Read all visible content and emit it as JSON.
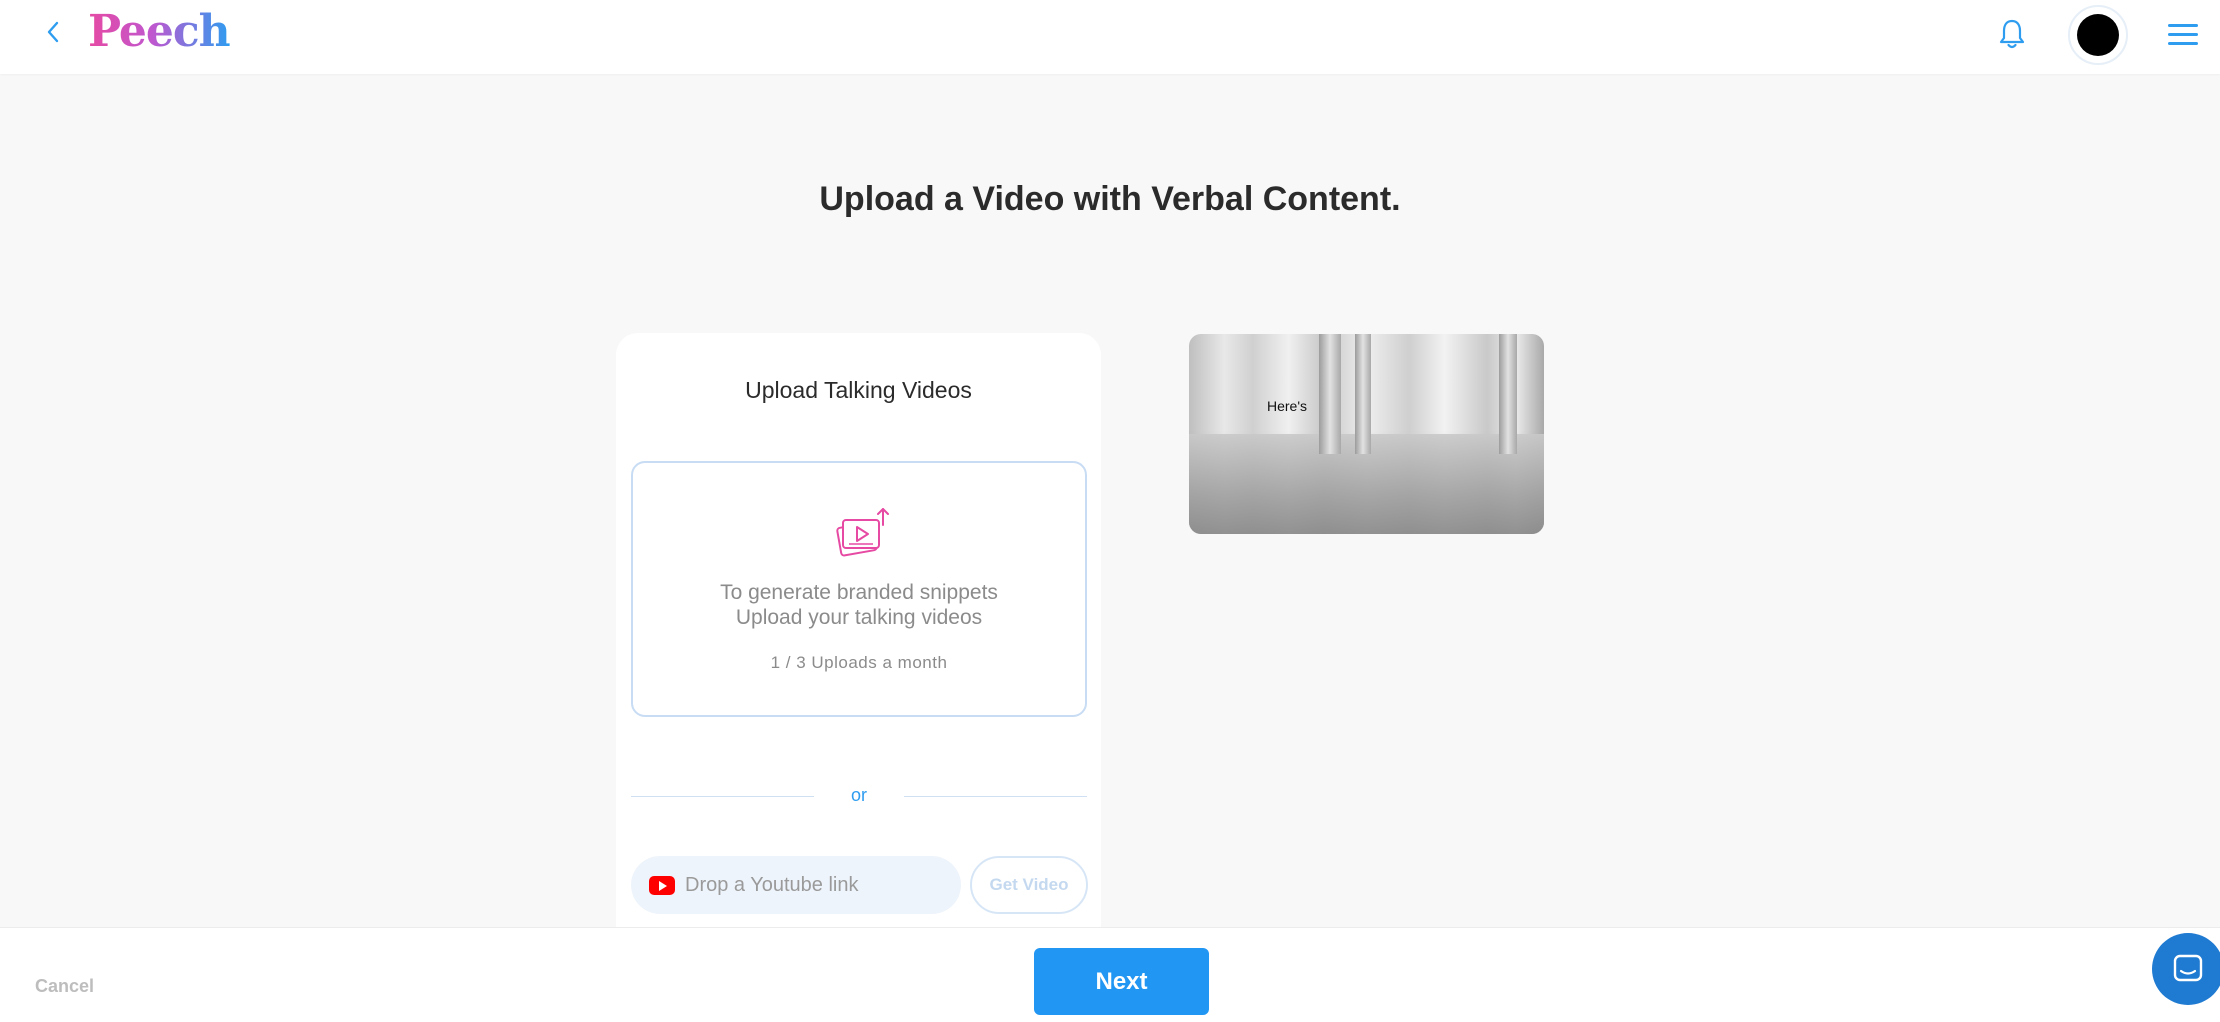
{
  "header": {
    "logo": "Peech",
    "back_icon": "chevron-left-icon",
    "notification_icon": "bell-icon",
    "menu_icon": "hamburger-menu-icon",
    "brand_colors": {
      "pink": "#e64aa3",
      "blue": "#2e9df0"
    }
  },
  "main": {
    "heading": "Upload a Video with Verbal Content."
  },
  "upload_card": {
    "title": "Upload Talking Videos",
    "dropzone": {
      "icon": "upload-video-icon",
      "line1": "To generate branded snippets",
      "line2": "Upload your talking videos",
      "quota": "1 / 3 Uploads a month"
    },
    "divider_text": "or",
    "youtube": {
      "icon": "youtube-icon",
      "placeholder": "Drop a Youtube link",
      "value": ""
    },
    "get_video_label": "Get Video"
  },
  "preview": {
    "caption": "Here's"
  },
  "footer": {
    "cancel_label": "Cancel",
    "next_label": "Next",
    "primary_color": "#2196f3"
  },
  "chat_widget": {
    "icon": "chat-icon"
  }
}
